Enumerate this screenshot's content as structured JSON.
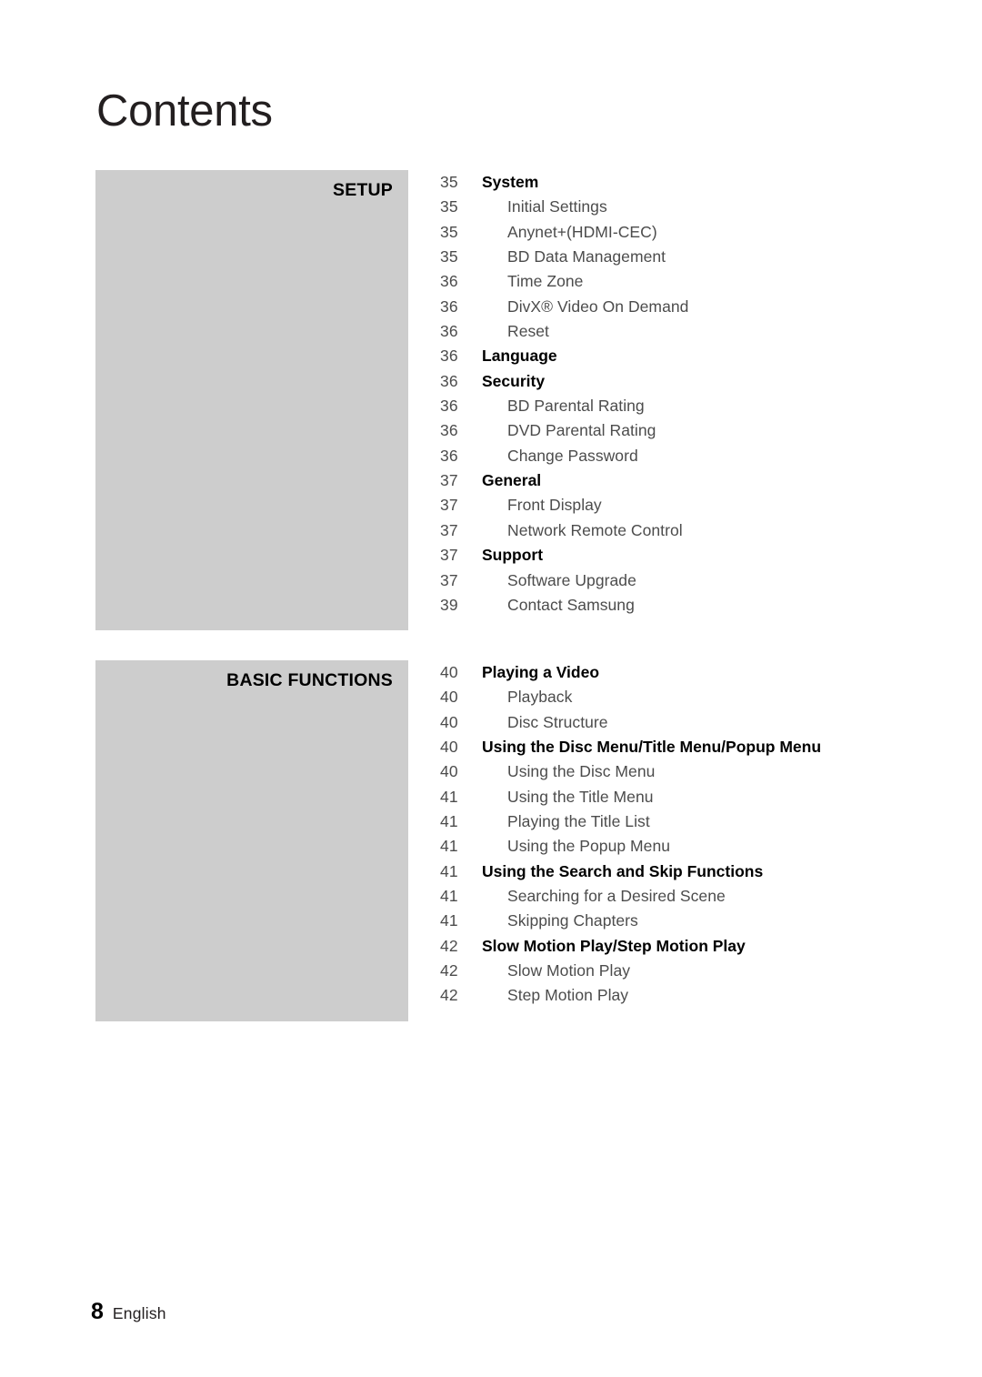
{
  "page": {
    "title": "Contents",
    "footer": {
      "number": "8",
      "label": "English"
    }
  },
  "sections": [
    {
      "label": "SETUP",
      "entries": [
        {
          "page": "35",
          "text": "System",
          "level": "heading"
        },
        {
          "page": "35",
          "text": "Initial Settings",
          "level": "sub"
        },
        {
          "page": "35",
          "text": "Anynet+(HDMI-CEC)",
          "level": "sub"
        },
        {
          "page": "35",
          "text": "BD Data Management",
          "level": "sub"
        },
        {
          "page": "36",
          "text": "Time Zone",
          "level": "sub"
        },
        {
          "page": "36",
          "text": "DivX® Video On Demand",
          "level": "sub"
        },
        {
          "page": "36",
          "text": "Reset",
          "level": "sub"
        },
        {
          "page": "36",
          "text": "Language",
          "level": "heading"
        },
        {
          "page": "36",
          "text": "Security",
          "level": "heading"
        },
        {
          "page": "36",
          "text": "BD Parental Rating",
          "level": "sub"
        },
        {
          "page": "36",
          "text": "DVD Parental Rating",
          "level": "sub"
        },
        {
          "page": "36",
          "text": "Change Password",
          "level": "sub"
        },
        {
          "page": "37",
          "text": "General",
          "level": "heading"
        },
        {
          "page": "37",
          "text": "Front Display",
          "level": "sub"
        },
        {
          "page": "37",
          "text": "Network Remote Control",
          "level": "sub"
        },
        {
          "page": "37",
          "text": "Support",
          "level": "heading"
        },
        {
          "page": "37",
          "text": "Software Upgrade",
          "level": "sub"
        },
        {
          "page": "39",
          "text": "Contact Samsung",
          "level": "sub"
        }
      ]
    },
    {
      "label": "BASIC FUNCTIONS",
      "entries": [
        {
          "page": "40",
          "text": "Playing a Video",
          "level": "heading"
        },
        {
          "page": "40",
          "text": "Playback",
          "level": "sub"
        },
        {
          "page": "40",
          "text": "Disc Structure",
          "level": "sub"
        },
        {
          "page": "40",
          "text": "Using the Disc Menu/Title Menu/Popup Menu",
          "level": "heading"
        },
        {
          "page": "40",
          "text": "Using the Disc Menu",
          "level": "sub"
        },
        {
          "page": "41",
          "text": "Using the Title Menu",
          "level": "sub"
        },
        {
          "page": "41",
          "text": "Playing the Title List",
          "level": "sub"
        },
        {
          "page": "41",
          "text": "Using the Popup Menu",
          "level": "sub"
        },
        {
          "page": "41",
          "text": "Using the Search and Skip Functions",
          "level": "heading"
        },
        {
          "page": "41",
          "text": "Searching for a Desired Scene",
          "level": "sub"
        },
        {
          "page": "41",
          "text": "Skipping Chapters",
          "level": "sub"
        },
        {
          "page": "42",
          "text": "Slow Motion Play/Step Motion Play",
          "level": "heading"
        },
        {
          "page": "42",
          "text": "Slow Motion Play",
          "level": "sub"
        },
        {
          "page": "42",
          "text": "Step Motion Play",
          "level": "sub"
        }
      ]
    }
  ],
  "colors": {
    "section_tab_background": "#cdcdcd",
    "page_number_text": "#4c4c4c",
    "heading_text": "#000000",
    "title_text": "#231f20",
    "page_background": "#ffffff"
  }
}
